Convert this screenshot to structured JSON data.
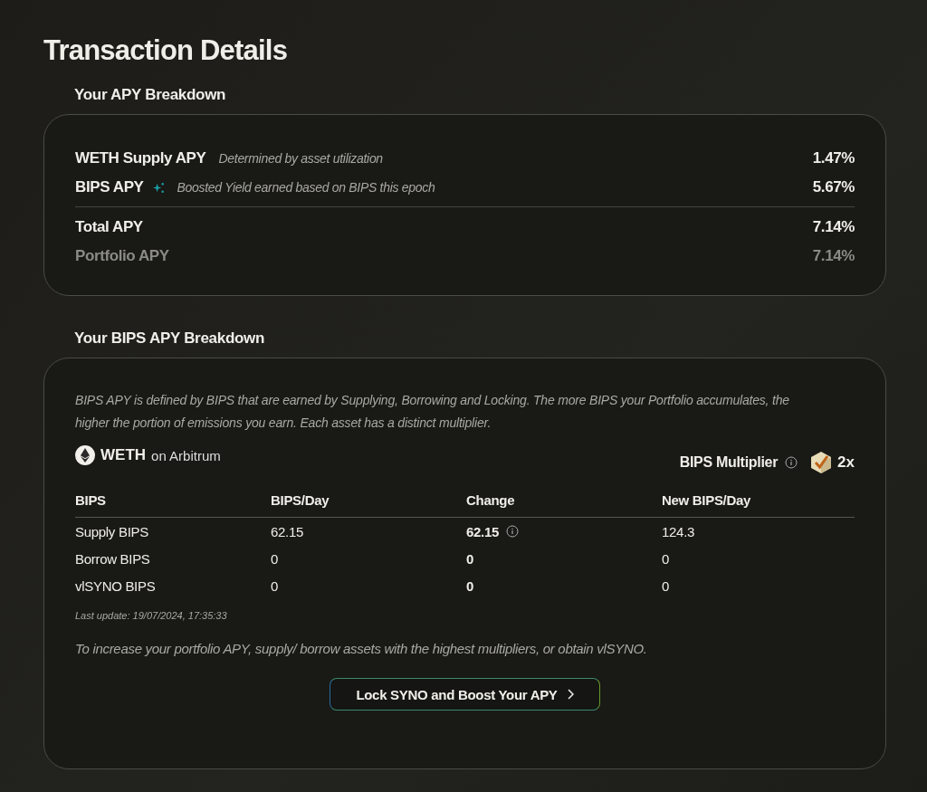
{
  "title": "Transaction Details",
  "apy_breakdown": {
    "heading": "Your APY Breakdown",
    "rows": [
      {
        "label": "WETH Supply APY",
        "sparkle": false,
        "note": "Determined by asset utilization",
        "value": "1.47%"
      },
      {
        "label": "BIPS APY",
        "sparkle": true,
        "note": "Boosted Yield earned based on BIPS this epoch",
        "value": "5.67%"
      }
    ],
    "totals": [
      {
        "kind": "main",
        "label": "Total APY",
        "value": "7.14%"
      },
      {
        "kind": "muted",
        "label": "Portfolio APY",
        "value": "7.14%"
      }
    ]
  },
  "bips_breakdown": {
    "heading": "Your BIPS APY Breakdown",
    "description": "BIPS APY is defined by BIPS that are earned by Supplying, Borrowing and Locking. The more BIPS your Portfolio accumulates, the higher the portion of emissions you earn. Each asset has a distinct multiplier.",
    "asset": {
      "name": "WETH",
      "network": "on Arbitrum"
    },
    "multiplier": {
      "label": "BIPS Multiplier",
      "value": "2x"
    },
    "columns": [
      "BIPS",
      "BIPS/Day",
      "Change",
      "New BIPS/Day"
    ],
    "rows": [
      {
        "name": "Supply BIPS",
        "per_day": "62.15",
        "change": "62.15",
        "change_info": true,
        "new_per_day": "124.3"
      },
      {
        "name": "Borrow BIPS",
        "per_day": "0",
        "change": "0",
        "change_info": false,
        "new_per_day": "0"
      },
      {
        "name": "vlSYNO BIPS",
        "per_day": "0",
        "change": "0",
        "change_info": false,
        "new_per_day": "0"
      }
    ],
    "last_update": "Last update: 19/07/2024, 17:35:33",
    "hint": "To increase your portfolio APY, supply/ borrow assets with the highest multipliers, or obtain vlSYNO.",
    "button": "Lock SYNO and Boost Your APY"
  }
}
